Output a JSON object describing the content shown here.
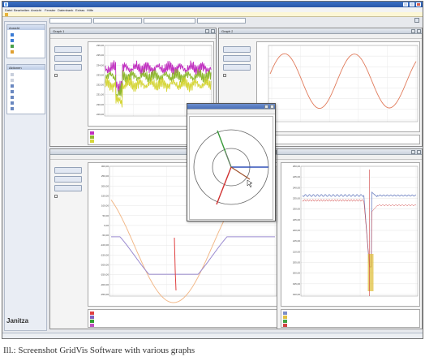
{
  "app": {
    "title": ""
  },
  "menu": [
    "Datei",
    "Bearbeiten",
    "Ansicht",
    "Fenster",
    "Datenbank",
    "Extras",
    "Hilfe"
  ],
  "status_path": "",
  "toolbar_tabs": [
    "",
    "",
    "",
    ""
  ],
  "sidebar": {
    "section1_title": "Ansicht",
    "section1_items": [
      "",
      "",
      "",
      ""
    ],
    "section2_title": "Aktionen",
    "section2_items": [
      "",
      "",
      "",
      "",
      "",
      "",
      ""
    ]
  },
  "brand": {
    "logo": "Janitza"
  },
  "statusbar": {
    "text": ""
  },
  "caption": "Ill.: Screenshot GridVis Software with various graphs",
  "common": {
    "menu": [
      "",
      "",
      "",
      ""
    ],
    "btn_zoom": "",
    "btn_measure": "",
    "btn_zoom_all": "",
    "chk_label": ""
  },
  "graph1": {
    "title": "Graph 1",
    "btn1": "",
    "btn2": "",
    "btn3": "",
    "chk": "",
    "yticks": [
      "236,00",
      "235,00",
      "234,00",
      "233,00",
      "232,00",
      "231,00",
      "230,00",
      "229,00"
    ],
    "xticks": [
      "",
      "",
      "",
      "",
      ""
    ],
    "xcaption": "",
    "legend": [
      {
        "label": "",
        "color": "#c030c0"
      },
      {
        "label": "",
        "color": "#8eb82e"
      },
      {
        "label": "",
        "color": "#d6d63a"
      }
    ]
  },
  "graph2": {
    "title": "Graph 2",
    "btn1": "",
    "btn2": "",
    "btn3": "",
    "chk": "",
    "yticks": [
      "",
      "",
      "",
      "",
      "",
      "",
      "",
      ""
    ],
    "xticks": [
      "",
      "",
      "",
      "",
      "",
      ""
    ],
    "xcaption": "",
    "legend": [
      {
        "label": "",
        "color": "#e07a5a"
      }
    ]
  },
  "graph3": {
    "title": "",
    "btn1": "",
    "btn2": "",
    "btn3": "",
    "chk": "",
    "yticks": [
      "300,00",
      "250,00",
      "200,00",
      "150,00",
      "100,00",
      "50,00",
      "0,00",
      "-50,00",
      "-100,00",
      "-150,00",
      "-200,00",
      "-250,00",
      "-300,00",
      "-350,00"
    ],
    "xticks": [
      "",
      "",
      "",
      ""
    ],
    "xcaption": "",
    "legend": [
      {
        "label": "",
        "color": "#e04040"
      },
      {
        "label": "",
        "color": "#8060c0"
      },
      {
        "label": "",
        "color": "#30a030"
      },
      {
        "label": "",
        "color": "#c050c0"
      }
    ]
  },
  "graph4": {
    "title": "",
    "btn1": "",
    "btn2": "",
    "btn3": "",
    "chk": "",
    "yticks": [
      "250,00",
      "245,00",
      "240,00",
      "235,00",
      "230,00",
      "225,00",
      "220,00",
      "215,00",
      "210,00",
      "205,00",
      "200,00",
      "195,00",
      "190,00"
    ],
    "xticks": [
      "",
      "",
      ""
    ],
    "xcaption": "",
    "legend": [
      {
        "label": "",
        "color": "#7c8ec8"
      },
      {
        "label": "",
        "color": "#e0c040"
      },
      {
        "label": "",
        "color": "#40a040"
      },
      {
        "label": "",
        "color": "#d04040"
      }
    ]
  },
  "phasor": {
    "title": "",
    "menu": [
      "",
      ""
    ],
    "labels": [
      "",
      "",
      "",
      ""
    ]
  }
}
